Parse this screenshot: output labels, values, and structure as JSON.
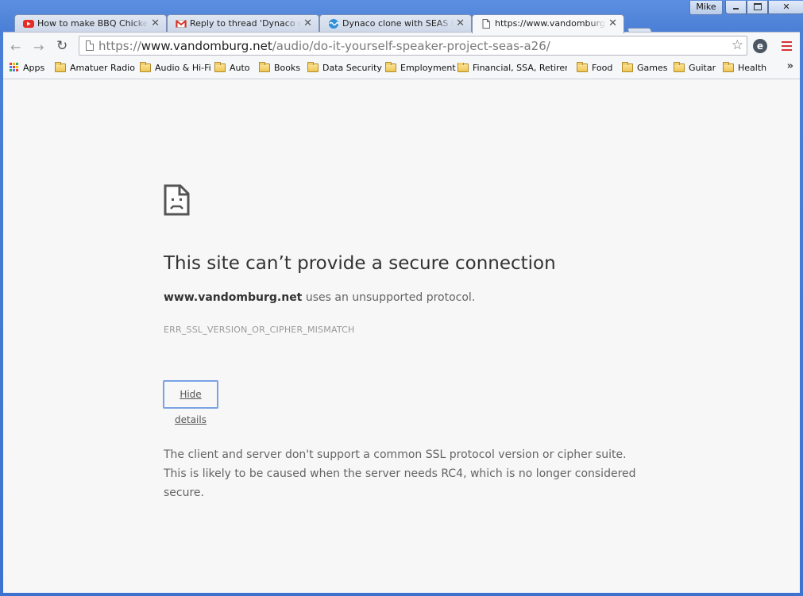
{
  "window": {
    "user_label": "Mike"
  },
  "tabs": [
    {
      "title": "How to make BBQ Chicken - I",
      "favicon": "youtube-icon",
      "active": false
    },
    {
      "title": "Reply to thread 'Dynaco clon",
      "favicon": "gmail-icon",
      "active": false
    },
    {
      "title": "Dynaco clone with SEAS Exoti",
      "favicon": "forum-icon",
      "active": false
    },
    {
      "title": "https://www.vandomburg.ne",
      "favicon": "page-icon",
      "active": true
    }
  ],
  "toolbar": {
    "url_scheme": "https://",
    "url_host": "www.vandomburg.net",
    "url_path": "/audio/do-it-yourself-speaker-project-seas-a26/"
  },
  "bookmarks": {
    "apps_label": "Apps",
    "folders": [
      "Amatuer Radio",
      "Audio & Hi-Fi",
      "Auto",
      "Books",
      "Data Security",
      "Employment",
      "Financial, SSA, Retireme",
      "Food",
      "Games",
      "Guitar",
      "Health"
    ],
    "overflow": "»"
  },
  "error": {
    "title": "This site can’t provide a secure connection",
    "host": "www.vandomburg.net",
    "description_suffix": " uses an unsupported protocol.",
    "code": "ERR_SSL_VERSION_OR_CIPHER_MISMATCH",
    "details_button": "Hide details",
    "details_text": "The client and server don't support a common SSL protocol version or cipher suite. This is likely to be caused when the server needs RC4, which is no longer considered secure."
  },
  "colors": {
    "window_frame": "#4a7fd6",
    "page_background": "#f7f7f7",
    "button_focus": "#7aa3e6",
    "menu_red": "#d83232"
  }
}
